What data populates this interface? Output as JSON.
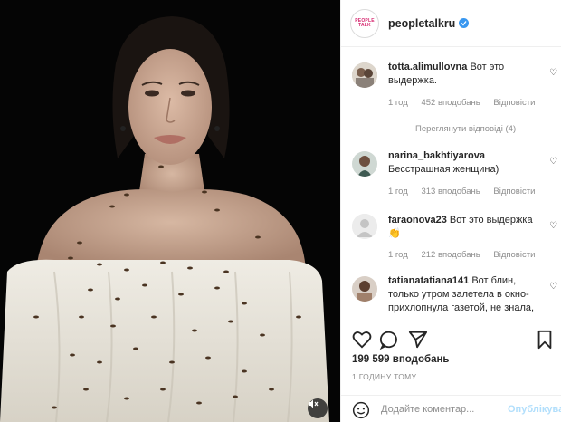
{
  "post": {
    "account": {
      "username": "peopletalkru",
      "avatar_text_line1": "PEOPLE",
      "avatar_text_line2": "TALK",
      "verified_icon": "verified-badge-icon"
    },
    "comments": [
      {
        "username": "totta.alimullovna",
        "text": "Вот это выдержка.",
        "time": "1 год",
        "likes": "452 вподобань",
        "reply": "Відповісти",
        "view_replies": "Переглянути відповіді (4)"
      },
      {
        "username": "narina_bakhtiyarova",
        "text": "Бесстрашная женщина)",
        "time": "1 год",
        "likes": "313 вподобань",
        "reply": "Відповісти"
      },
      {
        "username": "faraonova23",
        "text": "Вот это выдержка 👏",
        "time": "1 год",
        "likes": "212 вподобань",
        "reply": "Відповісти"
      },
      {
        "username": "tatianatatiana141",
        "text": "Вот блин, только утром залетела в окно- прихлопнула газетой, не знала,",
        "time": "",
        "likes": "",
        "reply": ""
      }
    ],
    "actions": {
      "like_icon": "heart-icon",
      "comment_icon": "comment-bubble-icon",
      "share_icon": "paper-plane-icon",
      "save_icon": "bookmark-icon"
    },
    "likes_count": "199 599 вподобань",
    "posted_time": "1 ГОДИНУ ТОМУ",
    "add_comment": {
      "placeholder": "Додайте коментар...",
      "publish_label": "Опублікувати",
      "emoji_icon": "emoji-smile-icon"
    },
    "media": {
      "mute_icon": "speaker-muted-icon"
    }
  }
}
